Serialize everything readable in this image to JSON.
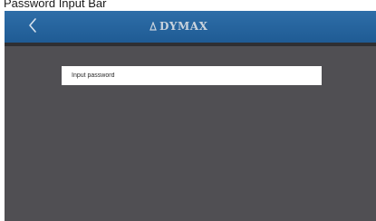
{
  "caption": "Password Input Bar",
  "header": {
    "back_icon": "chevron-left-icon",
    "logo_text": "DYMAX"
  },
  "password": {
    "placeholder": "Input password",
    "value": ""
  },
  "colors": {
    "header_blue": "#2369a6",
    "screen_background": "#504f53",
    "input_background": "#ffffff"
  }
}
